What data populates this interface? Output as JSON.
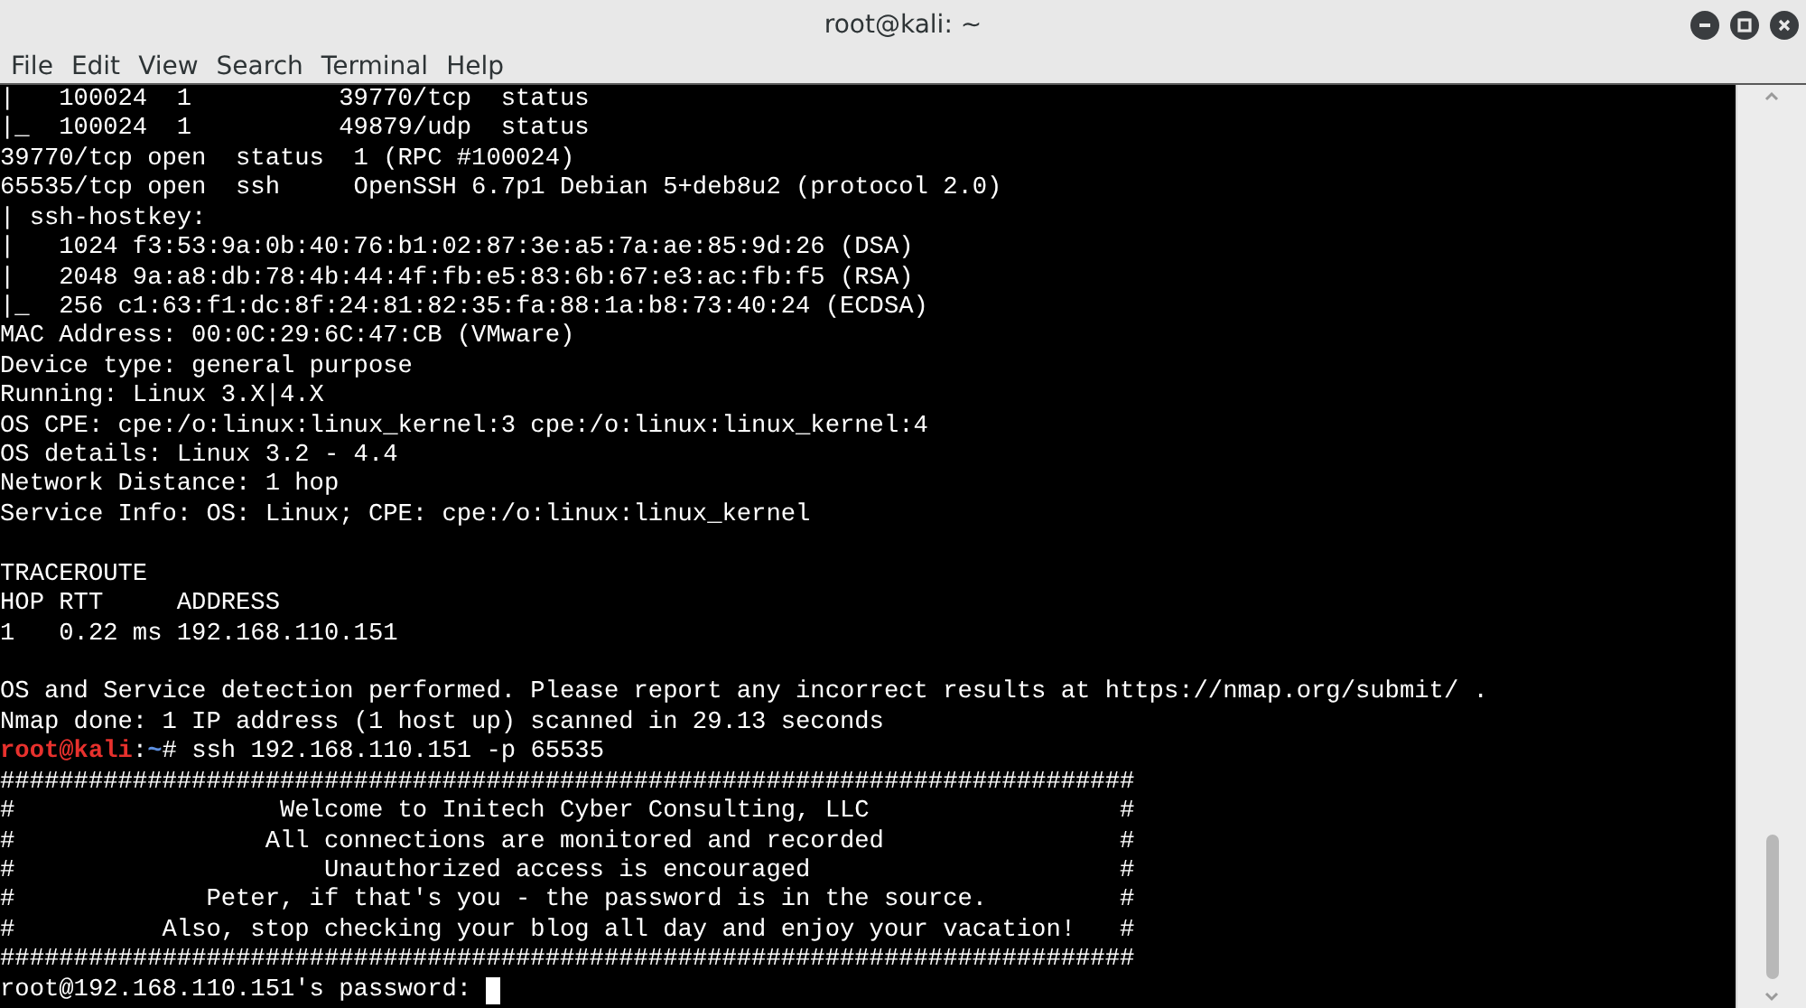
{
  "window": {
    "title": "root@kali: ~"
  },
  "menu": [
    "File",
    "Edit",
    "View",
    "Search",
    "Terminal",
    "Help"
  ],
  "terminal": {
    "lines": [
      {
        "kind": "output",
        "text": "|   100024  1          39770/tcp  status"
      },
      {
        "kind": "output",
        "text": "|_  100024  1          49879/udp  status"
      },
      {
        "kind": "output",
        "text": "39770/tcp open  status  1 (RPC #100024)"
      },
      {
        "kind": "output",
        "text": "65535/tcp open  ssh     OpenSSH 6.7p1 Debian 5+deb8u2 (protocol 2.0)"
      },
      {
        "kind": "output",
        "text": "| ssh-hostkey: "
      },
      {
        "kind": "output",
        "text": "|   1024 f3:53:9a:0b:40:76:b1:02:87:3e:a5:7a:ae:85:9d:26 (DSA)"
      },
      {
        "kind": "output",
        "text": "|   2048 9a:a8:db:78:4b:44:4f:fb:e5:83:6b:67:e3:ac:fb:f5 (RSA)"
      },
      {
        "kind": "output",
        "text": "|_  256 c1:63:f1:dc:8f:24:81:82:35:fa:88:1a:b8:73:40:24 (ECDSA)"
      },
      {
        "kind": "output",
        "text": "MAC Address: 00:0C:29:6C:47:CB (VMware)"
      },
      {
        "kind": "output",
        "text": "Device type: general purpose"
      },
      {
        "kind": "output",
        "text": "Running: Linux 3.X|4.X"
      },
      {
        "kind": "output",
        "text": "OS CPE: cpe:/o:linux:linux_kernel:3 cpe:/o:linux:linux_kernel:4"
      },
      {
        "kind": "output",
        "text": "OS details: Linux 3.2 - 4.4"
      },
      {
        "kind": "output",
        "text": "Network Distance: 1 hop"
      },
      {
        "kind": "output",
        "text": "Service Info: OS: Linux; CPE: cpe:/o:linux:linux_kernel"
      },
      {
        "kind": "blank"
      },
      {
        "kind": "output",
        "text": "TRACEROUTE"
      },
      {
        "kind": "output",
        "text": "HOP RTT     ADDRESS"
      },
      {
        "kind": "output",
        "text": "1   0.22 ms 192.168.110.151"
      },
      {
        "kind": "blank"
      },
      {
        "kind": "output",
        "text": "OS and Service detection performed. Please report any incorrect results at https://nmap.org/submit/ ."
      },
      {
        "kind": "output",
        "text": "Nmap done: 1 IP address (1 host up) scanned in 29.13 seconds"
      },
      {
        "kind": "prompt",
        "user_host": "root@kali",
        "separator": ":",
        "path": "~",
        "command": "# ssh 192.168.110.151 -p 65535"
      },
      {
        "kind": "output",
        "text": "#############################################################################"
      },
      {
        "kind": "output",
        "text": "#                  Welcome to Initech Cyber Consulting, LLC                 #"
      },
      {
        "kind": "output",
        "text": "#                 All connections are monitored and recorded                #"
      },
      {
        "kind": "output",
        "text": "#                     Unauthorized access is encouraged                     #"
      },
      {
        "kind": "output",
        "text": "#             Peter, if that's you - the password is in the source.         #"
      },
      {
        "kind": "output",
        "text": "#          Also, stop checking your blog all day and enjoy your vacation!   #"
      },
      {
        "kind": "output",
        "text": "#############################################################################"
      },
      {
        "kind": "input",
        "text": "root@192.168.110.151's password: ",
        "cursor": true
      }
    ]
  }
}
